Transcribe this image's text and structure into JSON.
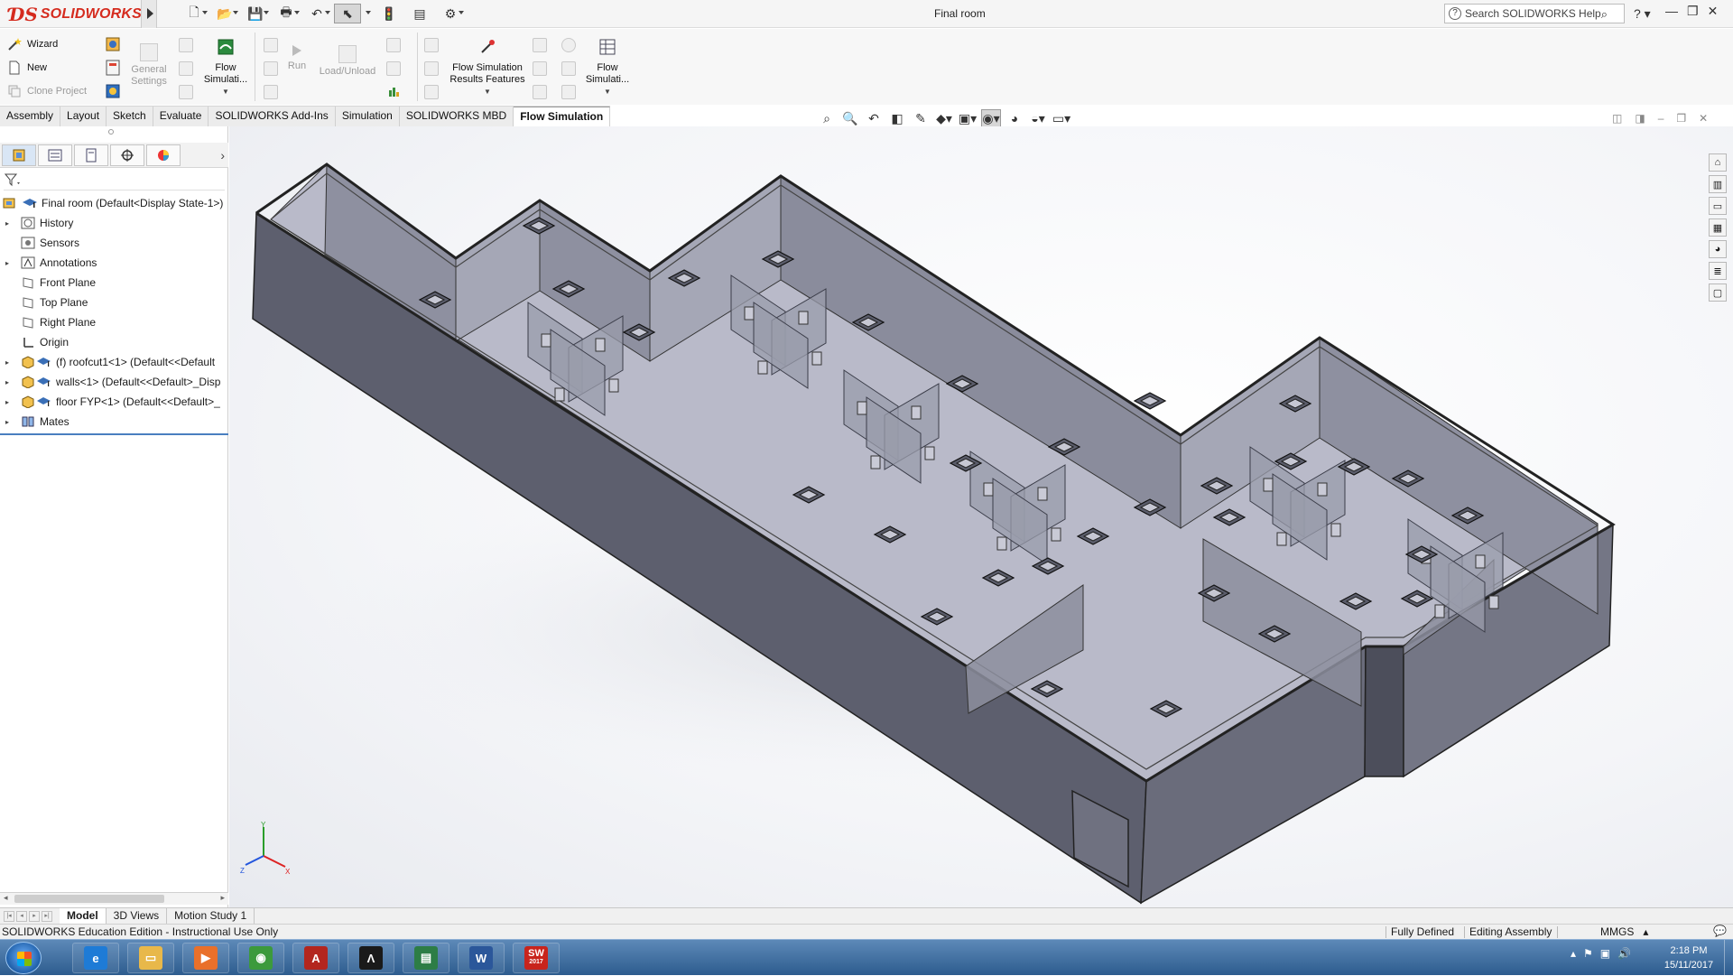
{
  "app": {
    "brand": "SOLIDWORKS",
    "document_title": "Final room",
    "search_placeholder": "Search SOLIDWORKS Help",
    "accent": "#d52b1e"
  },
  "ribbon": {
    "wizard": "Wizard",
    "new": "New",
    "clone_project": "Clone Project",
    "general_settings_1": "General",
    "general_settings_2": "Settings",
    "flow_sim_1": "Flow",
    "flow_sim_2": "Simulati...",
    "run": "Run",
    "load_unload": "Load/Unload",
    "results_1": "Flow Simulation",
    "results_2": "Results Features",
    "flow_sim_b1": "Flow",
    "flow_sim_b2": "Simulati..."
  },
  "tabs": [
    "Assembly",
    "Layout",
    "Sketch",
    "Evaluate",
    "SOLIDWORKS Add-Ins",
    "Simulation",
    "SOLIDWORKS MBD",
    "Flow Simulation"
  ],
  "active_tab": "Flow Simulation",
  "tree": {
    "root": "Final room  (Default<Display State-1>)",
    "items": [
      {
        "label": "History",
        "expandable": true,
        "icon": "history-icon"
      },
      {
        "label": "Sensors",
        "expandable": false,
        "icon": "sensor-icon"
      },
      {
        "label": "Annotations",
        "expandable": true,
        "icon": "annotation-icon"
      },
      {
        "label": "Front Plane",
        "expandable": false,
        "icon": "plane-icon"
      },
      {
        "label": "Top Plane",
        "expandable": false,
        "icon": "plane-icon"
      },
      {
        "label": "Right Plane",
        "expandable": false,
        "icon": "plane-icon"
      },
      {
        "label": "Origin",
        "expandable": false,
        "icon": "origin-icon"
      },
      {
        "label": "(f) roofcut1<1> (Default<<Default",
        "expandable": true,
        "icon": "part-icon"
      },
      {
        "label": "walls<1> (Default<<Default>_Disp",
        "expandable": true,
        "icon": "part-icon"
      },
      {
        "label": "floor FYP<1> (Default<<Default>_",
        "expandable": true,
        "icon": "part-icon"
      },
      {
        "label": "Mates",
        "expandable": true,
        "icon": "mates-icon"
      }
    ]
  },
  "bottom_tabs": [
    "Model",
    "3D Views",
    "Motion Study 1"
  ],
  "active_bottom_tab": "Model",
  "status": {
    "edition": "SOLIDWORKS Education Edition - Instructional Use Only",
    "defined": "Fully Defined",
    "editing": "Editing Assembly",
    "units": "MMGS"
  },
  "triad": {
    "x": "X",
    "y": "Y",
    "z": "Z"
  },
  "taskbar": {
    "apps": [
      "internet-explorer-icon",
      "file-explorer-icon",
      "media-player-icon",
      "chrome-icon",
      "acrobat-icon",
      "autodesk-icon",
      "matlab-icon",
      "word-icon",
      "solidworks-icon"
    ],
    "word_letter": "W",
    "sw_letter": "SW",
    "sw_year": "2017",
    "time": "2:18 PM",
    "date": "15/11/2017"
  }
}
